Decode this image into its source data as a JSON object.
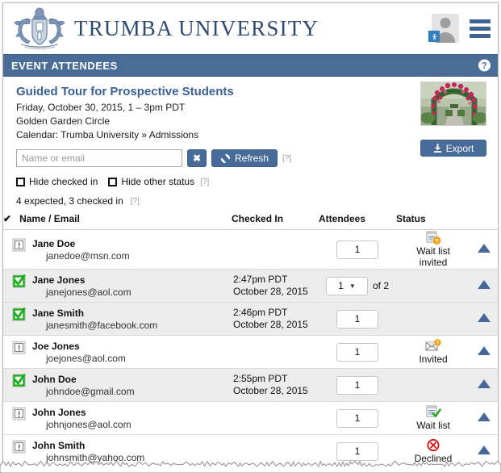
{
  "header": {
    "brand": "TRUMBA UNIVERSITY",
    "avatar_icon": "user-avatar-icon",
    "avatar_badge_icon": "accessibility-badge-icon",
    "menu_icon": "hamburger-menu-icon"
  },
  "section": {
    "title": "EVENT ATTENDEES",
    "help_icon": "help-question-icon",
    "bar_color": "#4a6c96"
  },
  "event": {
    "title": "Guided Tour for Prospective Students",
    "datetime": "Friday, October 30, 2015, 1 – 3pm PDT",
    "location": "Golden Garden Circle",
    "calendar_label": "Calendar:",
    "calendar_value": "Trumba University » Admissions",
    "thumbnail_icon": "rose-garden-arch-photo",
    "export_label": "Export",
    "export_icon": "download-icon",
    "title_color": "#3a6096"
  },
  "search": {
    "placeholder": "Name or email",
    "value": "",
    "clear_label": "✖",
    "clear_icon": "clear-x-icon",
    "refresh_label": "Refresh",
    "refresh_icon": "refresh-circular-arrows-icon",
    "hint": "[?]"
  },
  "filters": {
    "hide_checked_in": "Hide checked in",
    "hide_other_status": "Hide other status",
    "hint": "[?]",
    "hide_checked_in_checked": false,
    "hide_other_status_checked": false
  },
  "summary": {
    "text": "4 expected, 3 checked in",
    "hint": "[?]"
  },
  "table": {
    "headers": {
      "check": "✔",
      "name": "Name / Email",
      "checked_in": "Checked In",
      "attendees": "Attendees",
      "status": "Status"
    },
    "rows": [
      {
        "check_state": "unchecked",
        "check_icon": "unchecked-box-icon",
        "name": "Jane Doe",
        "email": "janedoe@msn.com",
        "checked_in_time": "",
        "checked_in_date": "",
        "attendees": "1",
        "has_select": false,
        "of_text": "",
        "status_icon": "waitlist-invited-icon",
        "status_label": "Wait list",
        "status_label2": "invited",
        "alt": false
      },
      {
        "check_state": "checked",
        "check_icon": "checked-box-icon",
        "name": "Jane Jones",
        "email": "janejones@aol.com",
        "checked_in_time": "2:47pm PDT",
        "checked_in_date": "October 28, 2015",
        "attendees": "1",
        "has_select": true,
        "of_text": "of  2",
        "status_icon": "",
        "status_label": "",
        "status_label2": "",
        "alt": true
      },
      {
        "check_state": "checked",
        "check_icon": "checked-box-icon",
        "name": "Jane Smith",
        "email": "janesmith@facebook.com",
        "checked_in_time": "2:46pm PDT",
        "checked_in_date": "October 28, 2015",
        "attendees": "1",
        "has_select": false,
        "of_text": "",
        "status_icon": "",
        "status_label": "",
        "status_label2": "",
        "alt": true
      },
      {
        "check_state": "unchecked",
        "check_icon": "unchecked-box-icon",
        "name": "Joe Jones",
        "email": "joejones@aol.com",
        "checked_in_time": "",
        "checked_in_date": "",
        "attendees": "1",
        "has_select": false,
        "of_text": "",
        "status_icon": "invited-envelope-icon",
        "status_label": "Invited",
        "status_label2": "",
        "alt": false
      },
      {
        "check_state": "checked",
        "check_icon": "checked-box-icon",
        "name": "John Doe",
        "email": "johndoe@gmail.com",
        "checked_in_time": "2:55pm PDT",
        "checked_in_date": "October 28, 2015",
        "attendees": "1",
        "has_select": false,
        "of_text": "",
        "status_icon": "",
        "status_label": "",
        "status_label2": "",
        "alt": true
      },
      {
        "check_state": "unchecked",
        "check_icon": "unchecked-box-icon",
        "name": "John Jones",
        "email": "johnjones@aol.com",
        "checked_in_time": "",
        "checked_in_date": "",
        "attendees": "1",
        "has_select": false,
        "of_text": "",
        "status_icon": "waitlist-icon",
        "status_label": "Wait list",
        "status_label2": "",
        "alt": false
      },
      {
        "check_state": "unchecked",
        "check_icon": "unchecked-box-icon",
        "name": "John Smith",
        "email": "johnsmith@yahoo.com",
        "checked_in_time": "",
        "checked_in_date": "",
        "attendees": "1",
        "has_select": false,
        "of_text": "",
        "status_icon": "declined-icon",
        "status_label": "Declined",
        "status_label2": "",
        "alt": false
      }
    ],
    "row_arrow_icon": "expand-up-triangle-icon"
  }
}
